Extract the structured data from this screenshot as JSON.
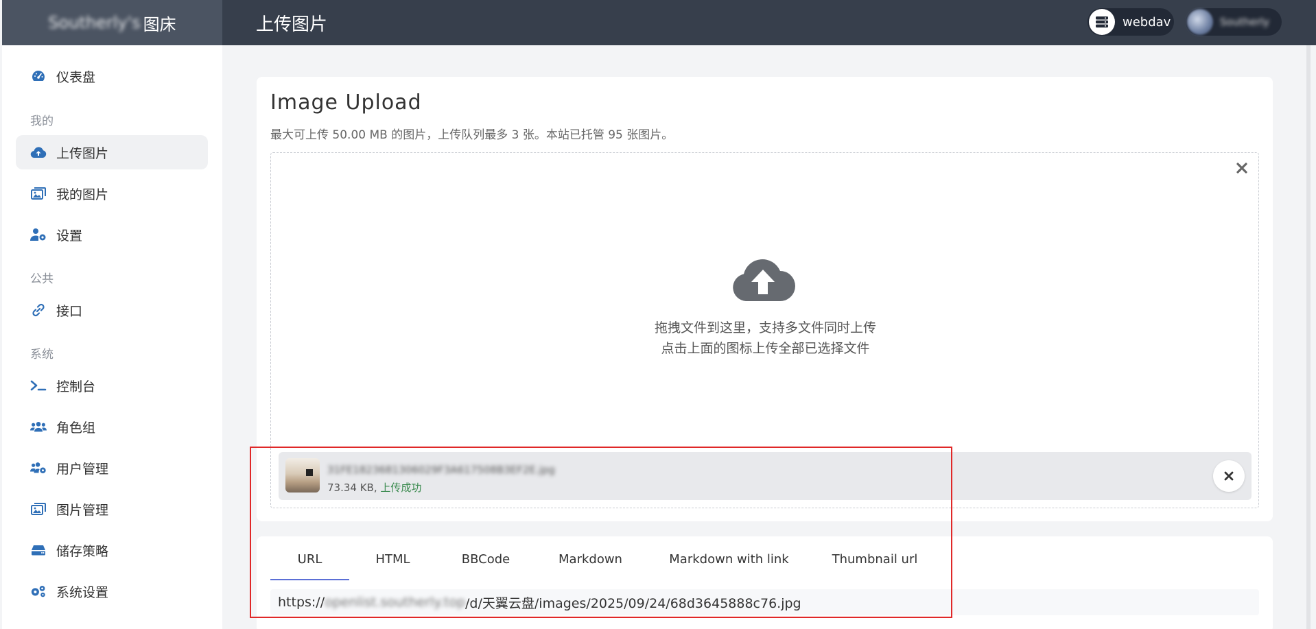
{
  "brand": {
    "blurred": "Southerly's",
    "suffix": "图床"
  },
  "header": {
    "title": "上传图片",
    "storage_label": "webdav",
    "user_name": "Southerly"
  },
  "sidebar": {
    "items": [
      {
        "label": "仪表盘",
        "icon": "dashboard-icon"
      },
      {
        "section": "我的"
      },
      {
        "label": "上传图片",
        "icon": "cloud-upload-icon",
        "active": true
      },
      {
        "label": "我的图片",
        "icon": "images-icon"
      },
      {
        "label": "设置",
        "icon": "user-gear-icon"
      },
      {
        "section": "公共"
      },
      {
        "label": "接口",
        "icon": "link-icon"
      },
      {
        "section": "系统"
      },
      {
        "label": "控制台",
        "icon": "terminal-icon"
      },
      {
        "label": "角色组",
        "icon": "users-icon"
      },
      {
        "label": "用户管理",
        "icon": "users-gear-icon"
      },
      {
        "label": "图片管理",
        "icon": "images-icon"
      },
      {
        "label": "储存策略",
        "icon": "hdd-icon"
      },
      {
        "label": "系统设置",
        "icon": "gears-icon"
      }
    ]
  },
  "upload": {
    "title": "Image Upload",
    "subtitle": "最大可上传 50.00 MB 的图片，上传队列最多 3 张。本站已托管 95 张图片。",
    "drop_line1": "拖拽文件到这里，支持多文件同时上传",
    "drop_line2": "点击上面的图标上传全部已选择文件",
    "file": {
      "name": "31FE1823681306029F3A617508B3EF2E.jpg",
      "size": "73.34 KB,",
      "status": "上传成功"
    }
  },
  "links": {
    "tabs": [
      "URL",
      "HTML",
      "BBCode",
      "Markdown",
      "Markdown with link",
      "Thumbnail url"
    ],
    "active_tab": "URL",
    "url_prefix": "https://",
    "url_blurred": "openlist.southerly.top",
    "url_rest": "/d/天翼云盘/images/2025/09/24/68d3645888c76.jpg"
  },
  "colors": {
    "header_bg": "#373f4c",
    "brand_bg": "#4b5462",
    "accent": "#5b6fd6",
    "success": "#3a8a4e",
    "annotation": "#e02828"
  }
}
